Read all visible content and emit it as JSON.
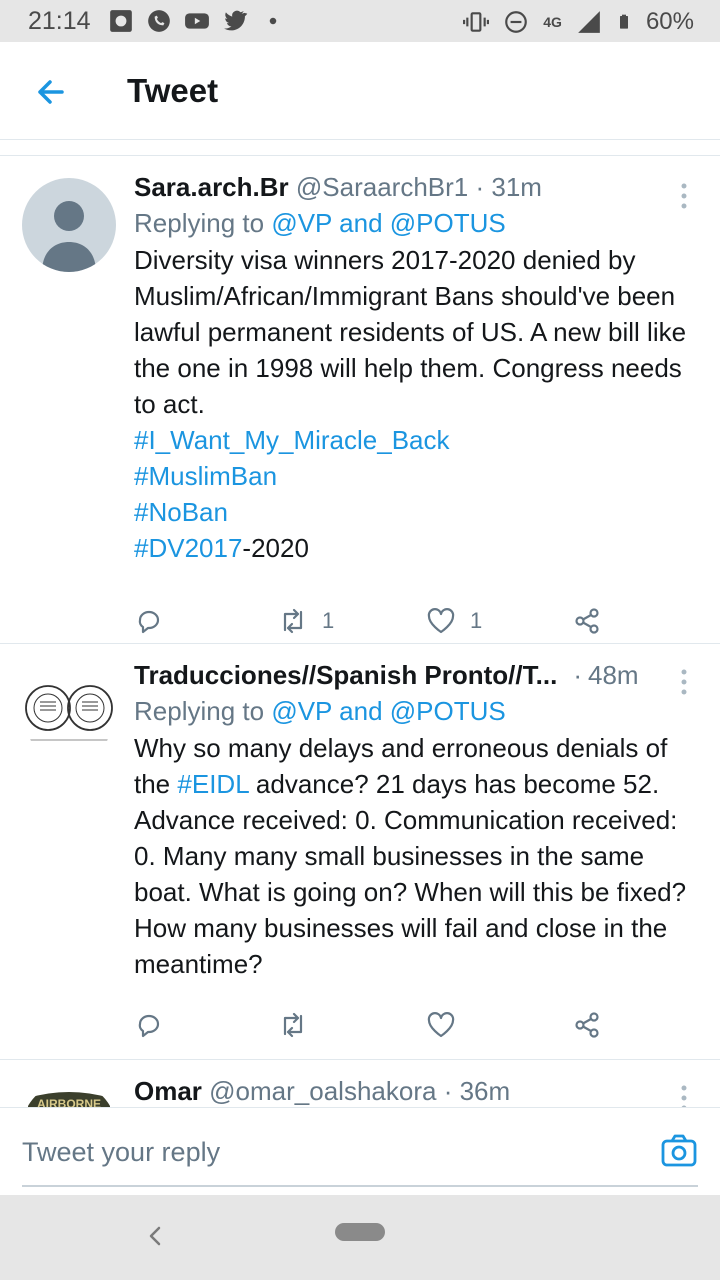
{
  "status_bar": {
    "time": "21:14",
    "network": "4G",
    "battery": "60%"
  },
  "header": {
    "title": "Tweet"
  },
  "tweets": [
    {
      "name": "Sara.arch.Br",
      "handle": "@SaraarchBr1",
      "time": "31m",
      "replying_prefix": "Replying to",
      "reply_to_1": "@VP",
      "reply_and": "and",
      "reply_to_2": "@POTUS",
      "text": "Diversity visa winners 2017-2020 denied by Muslim/African/Immigrant Bans should've been lawful permanent residents of US. A new bill like the one in 1998 will help them. Congress needs to act.",
      "hashtags": [
        "#I_Want_My_Miracle_Back",
        "#MuslimBan",
        "#NoBan",
        "#DV2017"
      ],
      "tag_suffix": "-2020",
      "retweets": "1",
      "likes": "1"
    },
    {
      "name": "Traducciones//Spanish Pronto//T...",
      "time": "48m",
      "replying_prefix": "Replying to",
      "reply_to_1": "@VP",
      "reply_and": "and",
      "reply_to_2": "@POTUS",
      "text_before": "Why so many delays and erroneous denials of the",
      "hashtag": "#EIDL",
      "text_after": "advance? 21 days has become 52. Advance received: 0. Communication received: 0. Many many small businesses in the same boat. What is going on? When will this be fixed? How many businesses will fail and close in the meantime?",
      "retweets": "",
      "likes": ""
    },
    {
      "name": "Omar",
      "handle": "@omar_oalshakora",
      "time": "36m",
      "avatar_text": "AIRBORNE"
    }
  ],
  "reply_bar": {
    "placeholder": "Tweet your reply"
  },
  "colors": {
    "accent": "#1b95e0",
    "text": "#14171a",
    "secondary": "#657786",
    "divider": "#e1e8ed"
  }
}
